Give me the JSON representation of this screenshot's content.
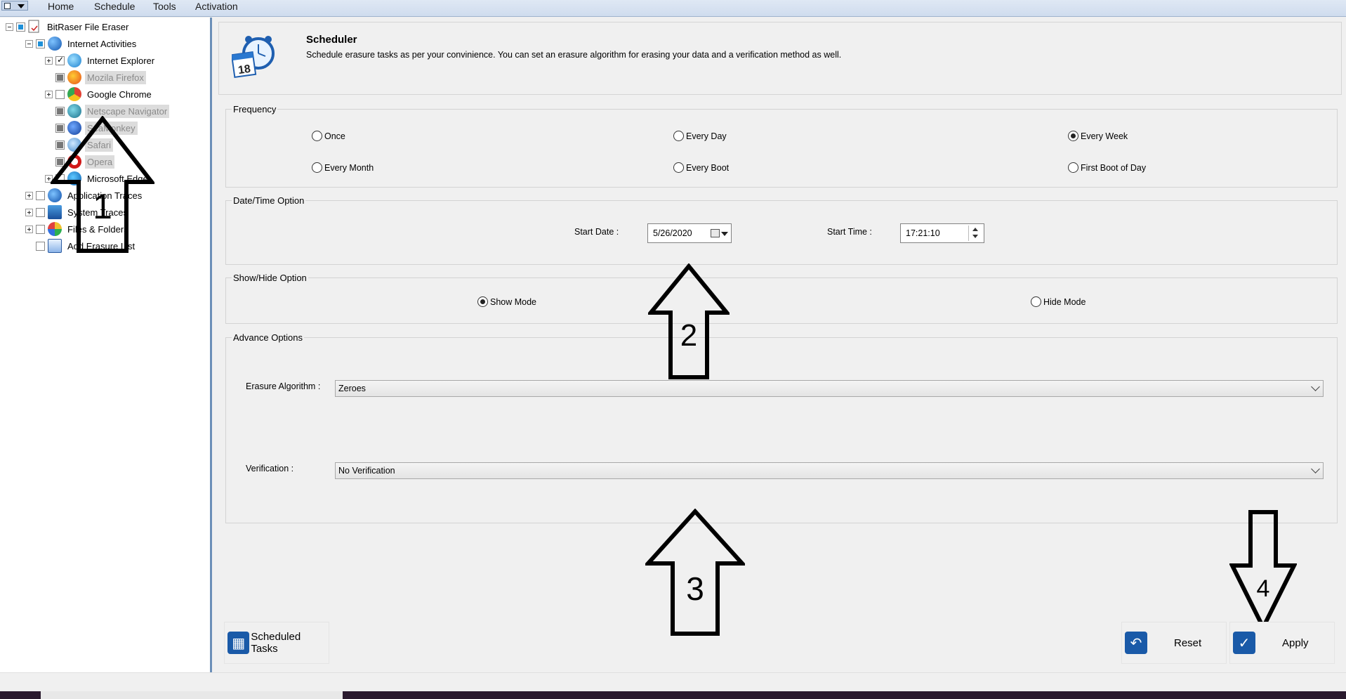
{
  "menu": {
    "items": [
      "Home",
      "Schedule",
      "Tools",
      "Activation"
    ]
  },
  "tree": {
    "root": "BitRaser File Eraser",
    "internet_activities": "Internet Activities",
    "browsers": [
      {
        "label": "Internet Explorer",
        "disabled": false
      },
      {
        "label": "Mozila Firefox",
        "disabled": true
      },
      {
        "label": "Google Chrome",
        "disabled": false
      },
      {
        "label": "Netscape Navigator",
        "disabled": true
      },
      {
        "label": "SeaMonkey",
        "disabled": true
      },
      {
        "label": "Safari",
        "disabled": true
      },
      {
        "label": "Opera",
        "disabled": true
      },
      {
        "label": "Microsoft Edge",
        "disabled": false
      }
    ],
    "application_traces": "Application Traces",
    "system_traces": "System Traces",
    "files": "Files & Folders",
    "add_erasure_list": "Add Erasure List"
  },
  "header": {
    "title": "Scheduler",
    "subtitle": "Schedule erasure tasks as per your convinience. You can set an erasure algorithm for erasing your data and a verification method as well.",
    "calendar_day": "18"
  },
  "frequency": {
    "title": "Frequency",
    "options": {
      "once": "Once",
      "every_day": "Every Day",
      "every_week": "Every Week",
      "every_month": "Every Month",
      "every_boot": "Every Boot",
      "first_boot": "First Boot of Day"
    },
    "selected": "every_week"
  },
  "datetime": {
    "title": "Date/Time Option",
    "start_date_label": "Start Date :",
    "start_date": "5/26/2020",
    "start_time_label": "Start Time :",
    "start_time": "17:21:10"
  },
  "showhide": {
    "title": "Show/Hide Option",
    "show": "Show Mode",
    "hide": "Hide Mode",
    "selected": "show"
  },
  "advance": {
    "title": "Advance Options",
    "algorithm_label": "Erasure Algorithm :",
    "algorithm": "Zeroes",
    "verification_label": "Verification :",
    "verification": "No Verification"
  },
  "buttons": {
    "scheduled_tasks": "Scheduled Tasks",
    "reset": "Reset",
    "apply": "Apply"
  },
  "annotations": [
    "1",
    "2",
    "3",
    "4"
  ],
  "colors": {
    "accent": "#1a5aa8",
    "panel_border": "#6b8fb8",
    "checkbox_partial": "#1e90d8"
  }
}
